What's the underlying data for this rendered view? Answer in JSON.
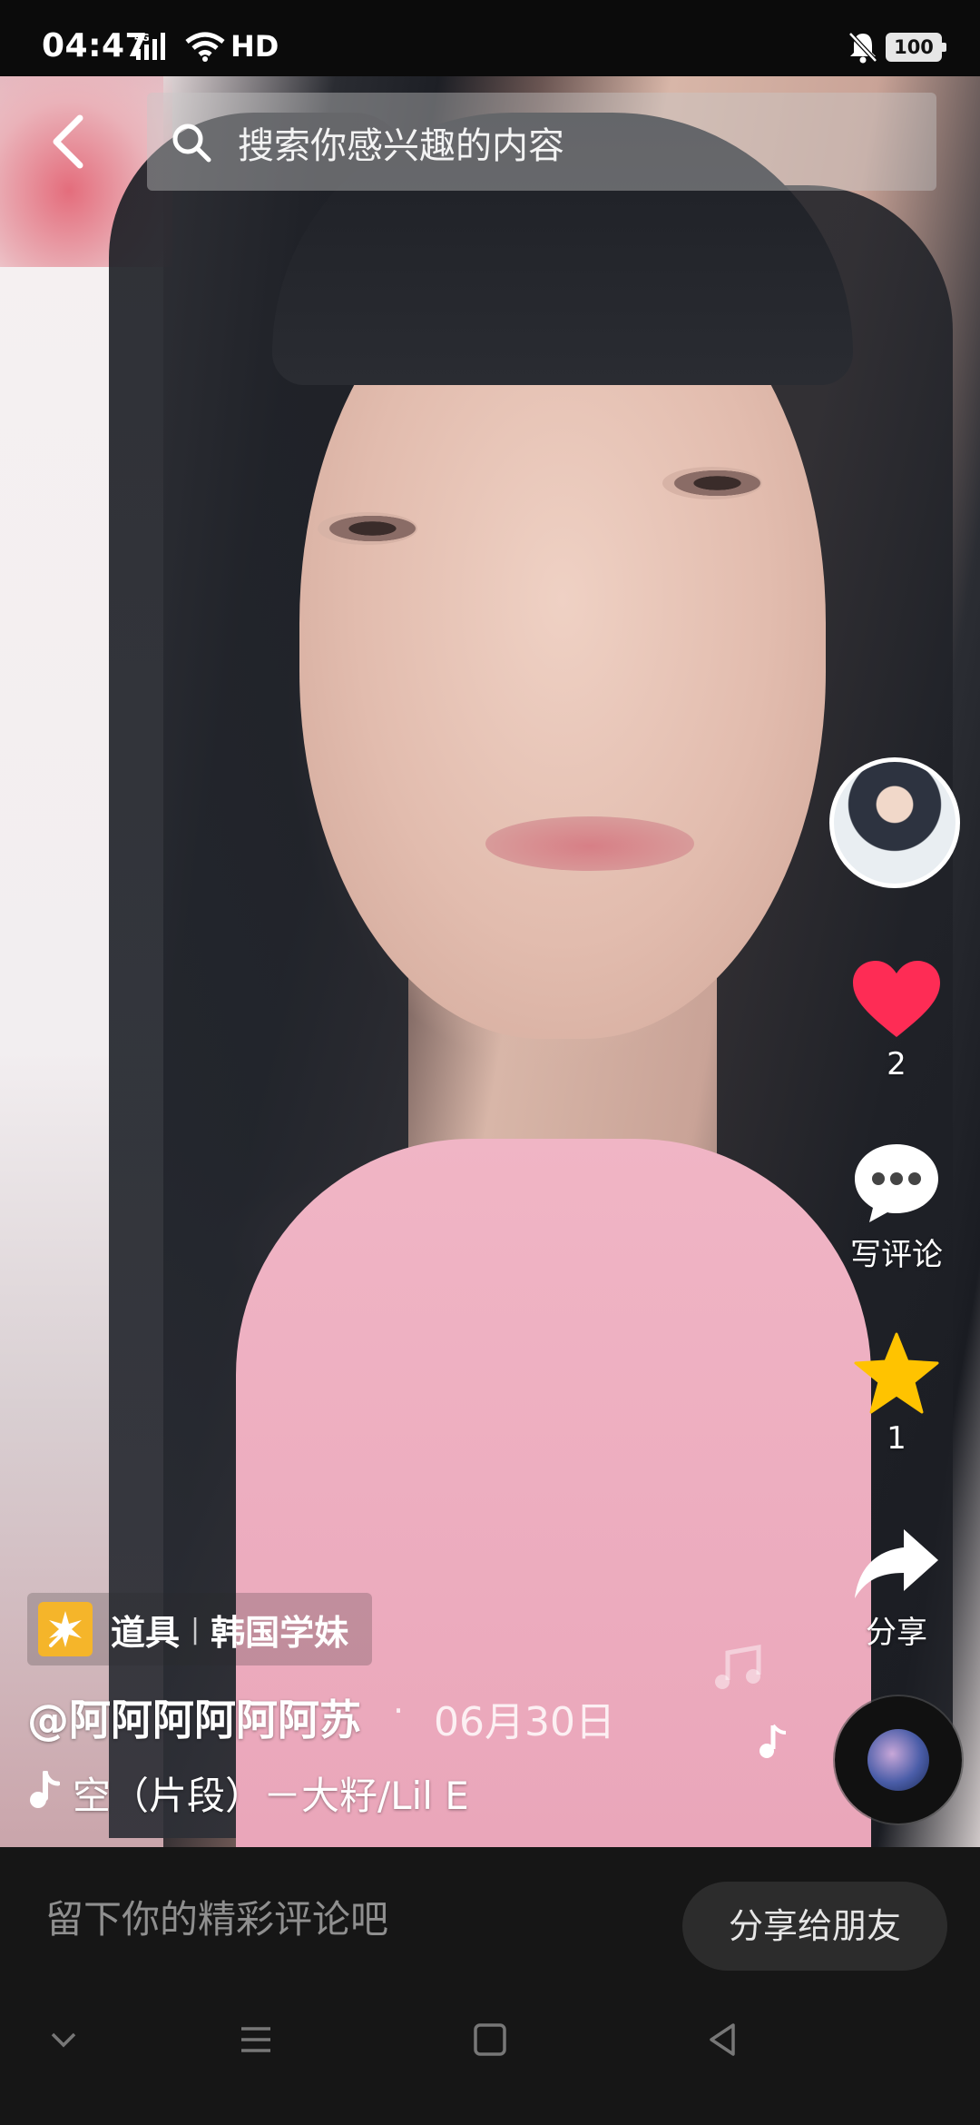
{
  "status_bar": {
    "time": "04:47",
    "network": "4G",
    "hd": "HD",
    "battery": "100"
  },
  "search": {
    "placeholder": "搜索你感兴趣的内容"
  },
  "rail": {
    "likes": "2",
    "comment_label": "写评论",
    "favorites": "1",
    "share_label": "分享"
  },
  "props": {
    "label": "道具",
    "separator": "|",
    "name": "韩国学妹"
  },
  "post": {
    "author": "@阿阿阿阿阿阿苏",
    "dot": "·",
    "date": "06月30日",
    "music": "空（片段）－大籽/Lil E"
  },
  "comment_bar": {
    "placeholder": "留下你的精彩评论吧",
    "share_button": "分享给朋友"
  },
  "colors": {
    "like": "#fe2c55",
    "favorite": "#ffc300",
    "props_icon": "#f5b52a"
  }
}
